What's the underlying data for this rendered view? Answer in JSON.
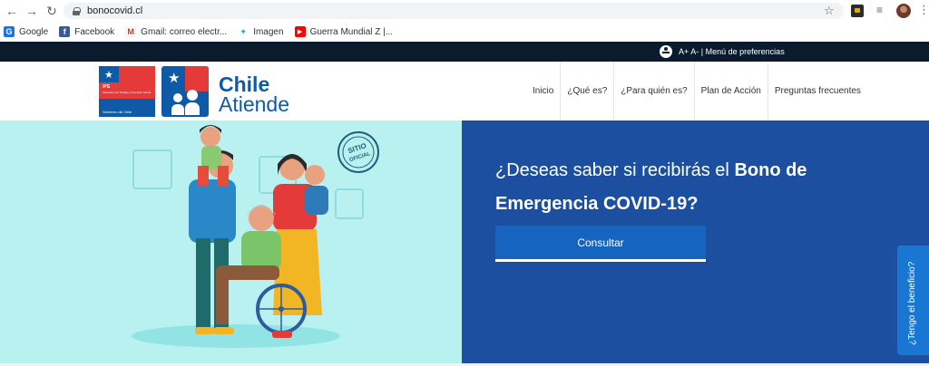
{
  "browser": {
    "url": "bonocovid.cl",
    "bookmarks": [
      {
        "label": "Google",
        "icon": "google-icon",
        "color": "#1a73e8"
      },
      {
        "label": "Facebook",
        "icon": "facebook-icon",
        "color": "#3b5998"
      },
      {
        "label": "Gmail: correo electr...",
        "icon": "gmail-icon",
        "color": "#d93025"
      },
      {
        "label": "Imagen",
        "icon": "twitter-icon",
        "color": "#1da1f2"
      },
      {
        "label": "Guerra Mundial Z |...",
        "icon": "youtube-icon",
        "color": "#ff0000"
      }
    ]
  },
  "accessibility": {
    "font_sizes": "A+ A-",
    "separator": "|",
    "preferences": "Menú de preferencias"
  },
  "header": {
    "ips_logo_text": "IPS",
    "ips_logo_sub": "Ministerio del Trabajo y Previsión Social",
    "ips_logo_gob": "Gobierno de Chile",
    "brand_line1": "Chile",
    "brand_line2": "Atiende",
    "nav": [
      {
        "label": "Inicio"
      },
      {
        "label": "¿Qué es?"
      },
      {
        "label": "¿Para quién es?"
      },
      {
        "label": "Plan de Acción"
      },
      {
        "label": "Preguntas frecuentes"
      }
    ]
  },
  "hero": {
    "title_plain": "¿Deseas saber si recibirás el ",
    "title_bold": "Bono de Emergencia COVID-19?",
    "cta_label": "Consultar",
    "seal_text": "SITIO OFICIAL"
  },
  "side_tab": {
    "label": "¿Tengo el beneficio?"
  },
  "colors": {
    "accent_dark": "#0b1b2e",
    "hero_blue": "#1c4f9f",
    "button_blue": "#1565c0",
    "hero_bg": "#b9f1f0",
    "brand_blue": "#0f5aa7",
    "brand_red": "#e53a3a"
  }
}
